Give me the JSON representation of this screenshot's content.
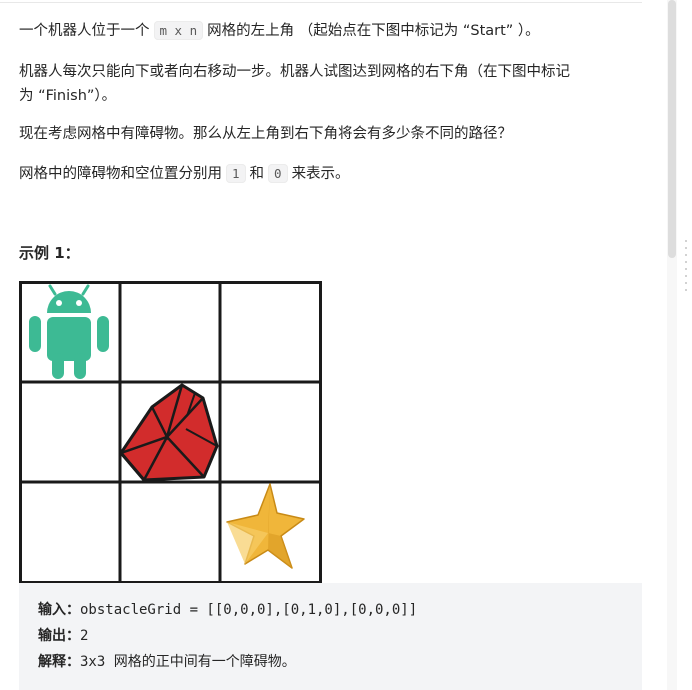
{
  "description": {
    "p1": {
      "before": "一个机器人位于一个",
      "code": "m x n",
      "after": "网格的左上角 （起始点在下图中标记为 “Start” ）。"
    },
    "p2": {
      "line1": "机器人每次只能向下或者向右移动一步。机器人试图达到网格的右下角（在下图中标记",
      "line2": "为 “Finish”）。"
    },
    "p3": "现在考虑网格中有障碍物。那么从左上角到右下角将会有多少条不同的路径？",
    "p4": {
      "before": "网格中的障碍物和空位置分别用",
      "code1": "1",
      "middle": "和",
      "code2": "0",
      "after": "来表示。"
    }
  },
  "example": {
    "heading": "示例 1：",
    "grid": {
      "rows": 3,
      "cols": 3,
      "start_icon": "android-robot-icon",
      "obstacle_icon": "red-gem-icon",
      "finish_icon": "gold-star-icon",
      "colors": {
        "robot": "#3dba94",
        "gem": "#d22c2c",
        "star": "#f0b63a",
        "line": "#1a1a1a"
      }
    },
    "input_label": "输入：",
    "input_value": "obstacleGrid = [[0,0,0],[0,1,0],[0,0,0]]",
    "output_label": "输出：",
    "output_value": "2",
    "explain_label": "解释：",
    "explain_value": "3x3 网格的正中间有一个障碍物。"
  }
}
